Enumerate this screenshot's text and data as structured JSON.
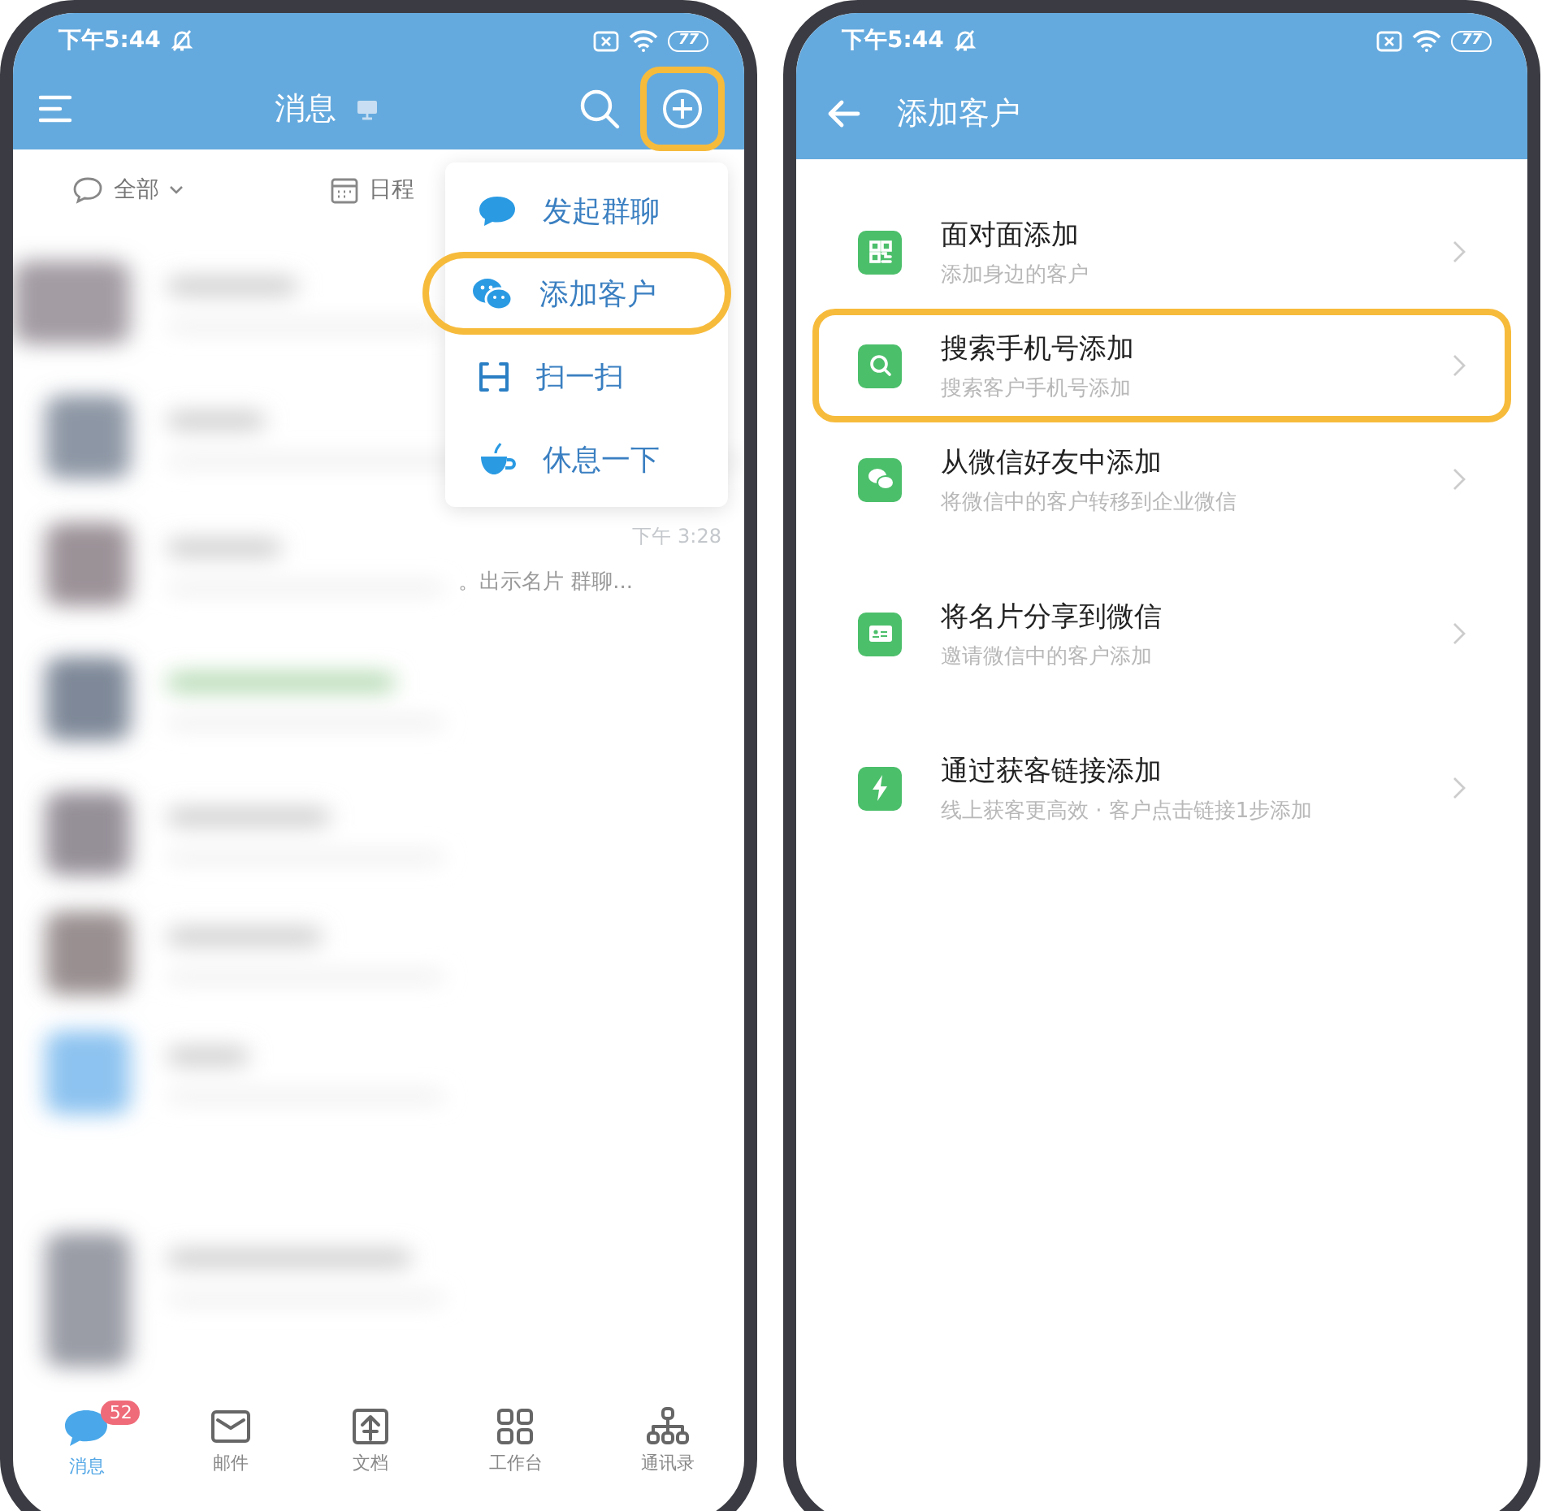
{
  "left_phone": {
    "status_bar": {
      "time": "下午5:44",
      "battery": "77"
    },
    "header": {
      "title": "消息",
      "add_highlighted": true
    },
    "filters": [
      {
        "kind": "chat",
        "label": "全部"
      },
      {
        "kind": "calendar",
        "label": "日程"
      }
    ],
    "popup_menu": [
      {
        "kind": "bubble",
        "label": "发起群聊",
        "highlighted": false
      },
      {
        "kind": "wechat",
        "label": "添加客户",
        "highlighted": true
      },
      {
        "kind": "scan",
        "label": "扫一扫",
        "highlighted": false
      },
      {
        "kind": "cup",
        "label": "休息一下",
        "highlighted": false
      }
    ],
    "visible_message": {
      "time": "下午 3:28",
      "preview": "。出示名片 群聊..."
    },
    "tab_bar": [
      {
        "kind": "chat",
        "label": "消息",
        "selected": true,
        "badge": "52"
      },
      {
        "kind": "mail",
        "label": "邮件",
        "selected": false
      },
      {
        "kind": "doc",
        "label": "文档",
        "selected": false
      },
      {
        "kind": "grid",
        "label": "工作台",
        "selected": false
      },
      {
        "kind": "org",
        "label": "通讯录",
        "selected": false
      }
    ]
  },
  "right_phone": {
    "status_bar": {
      "time": "下午5:44",
      "battery": "77"
    },
    "header": {
      "title": "添加客户"
    },
    "sections": [
      {
        "items": [
          {
            "kind": "qr",
            "title": "面对面添加",
            "subtitle": "添加身边的客户",
            "highlighted": false
          },
          {
            "kind": "search",
            "title": "搜索手机号添加",
            "subtitle": "搜索客户手机号添加",
            "highlighted": true
          },
          {
            "kind": "wechat",
            "title": "从微信好友中添加",
            "subtitle": "将微信中的客户转移到企业微信",
            "highlighted": false
          }
        ]
      },
      {
        "items": [
          {
            "kind": "card",
            "title": "将名片分享到微信",
            "subtitle": "邀请微信中的客户添加",
            "highlighted": false
          },
          {
            "kind": "bolt",
            "title": "通过获客链接添加",
            "subtitle": "线上获客更高效 · 客户点击链接1步添加",
            "highlighted": false
          }
        ]
      }
    ]
  }
}
